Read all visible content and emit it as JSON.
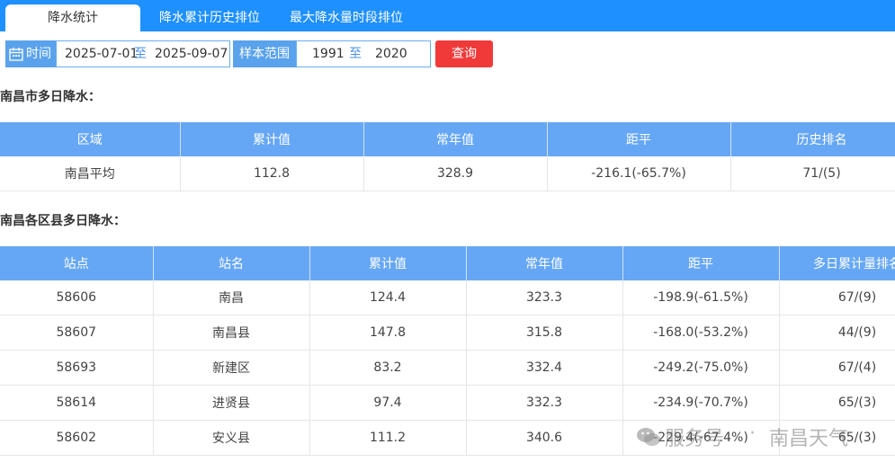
{
  "tabs": [
    {
      "label": "降水统计"
    },
    {
      "label": "降水累计历史排位"
    },
    {
      "label": "最大降水量时段排位"
    }
  ],
  "filter": {
    "time_label": "时间",
    "start_date": "2025-07-01",
    "date_sep": "至",
    "end_date": "2025-09-07",
    "sample_label": "样本范围",
    "start_year": "1991",
    "year_sep": "至",
    "end_year": "2020",
    "query_button": "查询"
  },
  "section1": {
    "title": "南昌市多日降水：",
    "headers": [
      "区域",
      "累计值",
      "常年值",
      "距平",
      "历史排名"
    ],
    "rows": [
      [
        "南昌平均",
        "112.8",
        "328.9",
        "-216.1(-65.7%)",
        "71/(5)"
      ]
    ]
  },
  "section2": {
    "title": "南昌各区县多日降水：",
    "headers": [
      "站点",
      "站名",
      "累计值",
      "常年值",
      "距平",
      "多日累计量排名"
    ],
    "rows": [
      [
        "58606",
        "南昌",
        "124.4",
        "323.3",
        "-198.9(-61.5%)",
        "67/(9)"
      ],
      [
        "58607",
        "南昌县",
        "147.8",
        "315.8",
        "-168.0(-53.2%)",
        "44/(9)"
      ],
      [
        "58693",
        "新建区",
        "83.2",
        "332.4",
        "-249.2(-75.0%)",
        "67/(4)"
      ],
      [
        "58614",
        "进贤县",
        "97.4",
        "332.3",
        "-234.9(-70.7%)",
        "65/(3)"
      ],
      [
        "58602",
        "安义县",
        "111.2",
        "340.6",
        "-229.4(-67.4%)",
        "65/(3)"
      ]
    ]
  },
  "watermark": {
    "text": "服务号",
    "dot": "·",
    "name": "南昌天气"
  }
}
